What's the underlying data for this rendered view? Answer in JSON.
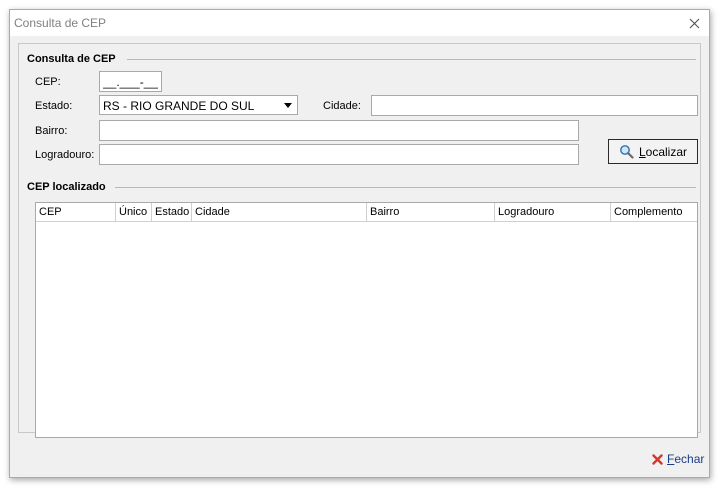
{
  "window": {
    "title": "Consulta de CEP"
  },
  "search_group": {
    "title": "Consulta de CEP",
    "cep_label": "CEP:",
    "cep_value": "__.___-___",
    "estado_label": "Estado:",
    "estado_value": "RS - RIO GRANDE DO SUL",
    "cidade_label": "Cidade:",
    "cidade_value": "",
    "bairro_label": "Bairro:",
    "bairro_value": "",
    "logradouro_label": "Logradouro:",
    "logradouro_value": "",
    "localizar_hotkey": "L",
    "localizar_rest": "ocalizar"
  },
  "result_group": {
    "title": "CEP localizado",
    "columns": [
      "CEP",
      "Único",
      "Estado",
      "Cidade",
      "Bairro",
      "Logradouro",
      "Complemento"
    ]
  },
  "footer": {
    "fechar_hotkey": "F",
    "fechar_rest": "echar"
  },
  "colors": {
    "window_bg": "#f0f0f0",
    "accent_link": "#1c3b8a",
    "close_icon_red": "#d9362b"
  },
  "icons": {
    "window_close": "close-icon",
    "search": "magnifier-icon",
    "dropdown": "chevron-down-icon",
    "fechar": "red-x-icon"
  }
}
